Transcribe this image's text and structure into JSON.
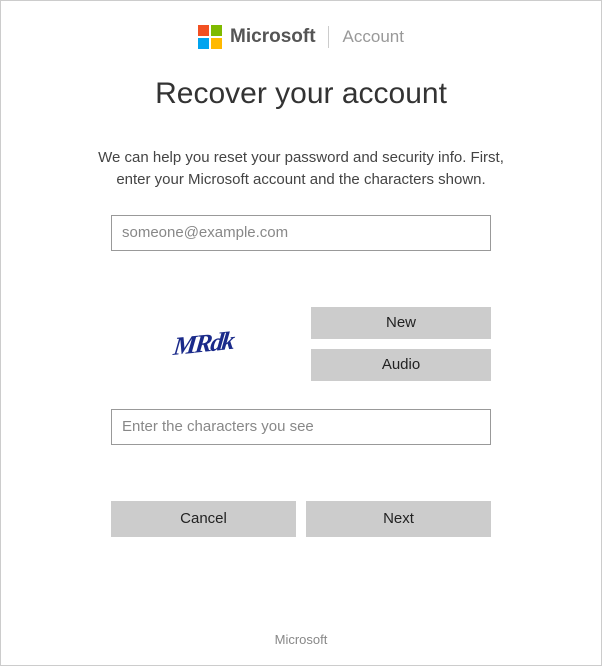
{
  "header": {
    "brand": "Microsoft",
    "section": "Account"
  },
  "main": {
    "title": "Recover your account",
    "instructions": "We can help you reset your password and security info. First, enter your Microsoft account and the characters shown.",
    "email_placeholder": "someone@example.com",
    "captcha_text": "MRdk",
    "btn_new": "New",
    "btn_audio": "Audio",
    "captcha_input_placeholder": "Enter the characters you see",
    "btn_cancel": "Cancel",
    "btn_next": "Next"
  },
  "footer": {
    "text": "Microsoft"
  }
}
